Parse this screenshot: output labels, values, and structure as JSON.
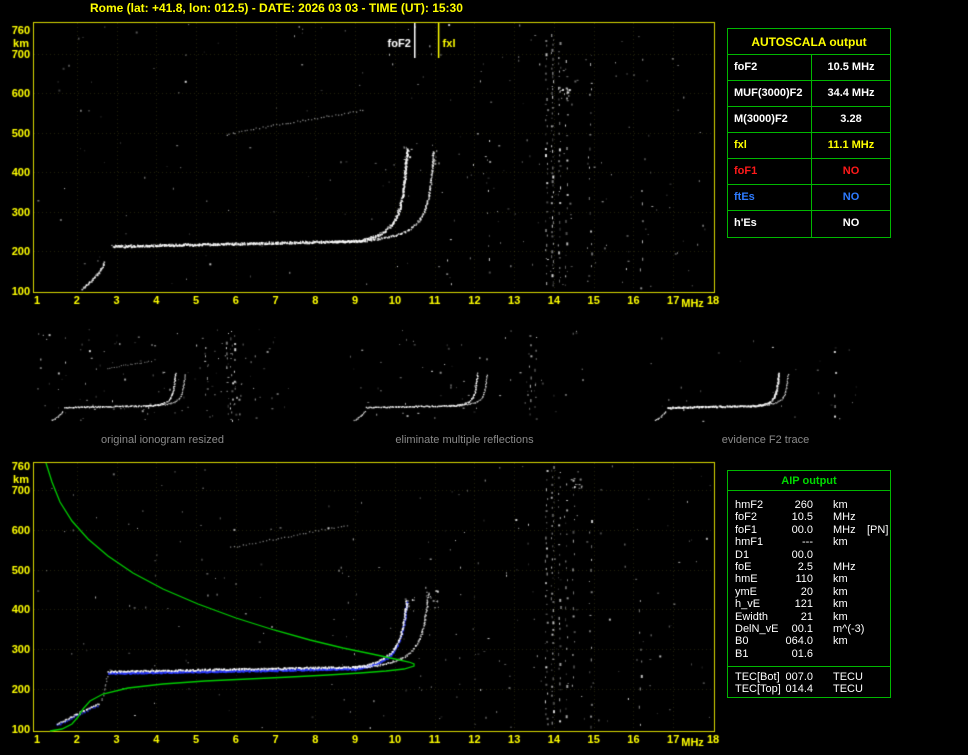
{
  "title": "Rome (lat: +41.8, lon: 012.5) - DATE: 2026 03 03 - TIME (UT): 15:30",
  "colors": {
    "yellow": "#ffff00",
    "plot-border": "#d8d800",
    "green": "#00b800",
    "green-bright": "#00d800",
    "red": "#ff1a1a",
    "blue": "#2e7bff",
    "white": "#ffffff",
    "caption-gray": "#8a8a8a",
    "trace-blue": "#2838ff",
    "profile-green": "#00cc00"
  },
  "top_plot": {
    "y_axis_unit": "km",
    "x_axis_unit": "MHz",
    "y_ticks": [
      760,
      700,
      600,
      500,
      400,
      300,
      200,
      100
    ],
    "x_ticks": [
      1,
      2,
      3,
      4,
      5,
      6,
      7,
      8,
      9,
      10,
      11,
      12,
      13,
      14,
      15,
      16,
      17,
      18
    ],
    "markers": {
      "fof2_label": "foF2",
      "fof2_mhz": 10.5,
      "fxl_label": "fxl",
      "fxl_mhz": 11.1
    }
  },
  "bottom_plot": {
    "y_axis_unit": "km",
    "x_axis_unit": "MHz",
    "y_ticks": [
      760,
      700,
      600,
      500,
      400,
      300,
      200,
      100
    ],
    "x_ticks": [
      1,
      2,
      3,
      4,
      5,
      6,
      7,
      8,
      9,
      10,
      11,
      12,
      13,
      14,
      15,
      16,
      17,
      18
    ]
  },
  "autoscala_table": {
    "title": "AUTOSCALA output",
    "rows": [
      {
        "label": "foF2",
        "value": "10.5 MHz",
        "color": "#ffffff"
      },
      {
        "label": "MUF(3000)F2",
        "value": "34.4 MHz",
        "color": "#ffffff"
      },
      {
        "label": "M(3000)F2",
        "value": "3.28",
        "color": "#ffffff"
      },
      {
        "label": "fxl",
        "value": "11.1 MHz",
        "color": "#ffff00"
      },
      {
        "label": "foF1",
        "value": "NO",
        "color": "#ff1a1a"
      },
      {
        "label": "ftEs",
        "value": "NO",
        "color": "#2e7bff"
      },
      {
        "label": "h'Es",
        "value": "NO",
        "color": "#ffffff"
      }
    ]
  },
  "thumbnails": [
    {
      "caption": "original ionogram resized"
    },
    {
      "caption": "eliminate multiple reflections"
    },
    {
      "caption": "evidence F2 trace"
    }
  ],
  "aip_table": {
    "title": "AIP output",
    "rows": [
      {
        "label": "hmF2",
        "value": "260",
        "unit": "km"
      },
      {
        "label": "foF2",
        "value": "10.5",
        "unit": "MHz"
      },
      {
        "label": "foF1",
        "value": "00.0",
        "unit": "MHz",
        "extra": "[PN]"
      },
      {
        "label": "hmF1",
        "value": "---",
        "unit": "km"
      },
      {
        "label": "D1",
        "value": "00.0",
        "unit": ""
      },
      {
        "label": "foE",
        "value": "2.5",
        "unit": "MHz"
      },
      {
        "label": "hmE",
        "value": "110",
        "unit": "km"
      },
      {
        "label": "ymE",
        "value": "20",
        "unit": "km"
      },
      {
        "label": "h_vE",
        "value": "121",
        "unit": "km"
      },
      {
        "label": "Ewidth",
        "value": "21",
        "unit": "km"
      },
      {
        "label": "DelN_vE",
        "value": "00.1",
        "unit": "m^(-3)"
      },
      {
        "label": "B0",
        "value": "064.0",
        "unit": "km"
      },
      {
        "label": "B1",
        "value": "01.6",
        "unit": ""
      }
    ],
    "tec_rows": [
      {
        "label": "TEC[Bot]",
        "value": "007.0",
        "unit": "TECU"
      },
      {
        "label": "TEC[Top]",
        "value": "014.4",
        "unit": "TECU"
      }
    ]
  }
}
